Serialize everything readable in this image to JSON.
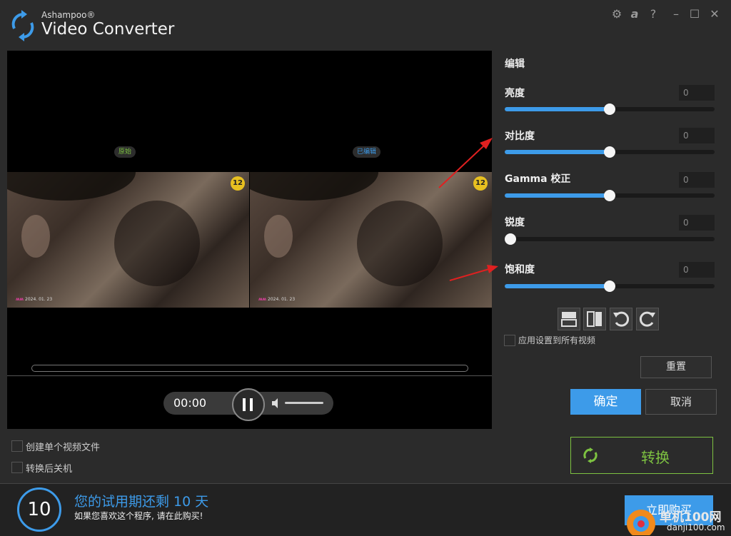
{
  "app": {
    "brand_small": "Ashampoo®",
    "title": "Video Converter"
  },
  "window_controls": [
    "gear-icon",
    "ashampoo-a-icon",
    "help-icon",
    "minimize-icon",
    "maximize-icon",
    "close-icon"
  ],
  "preview": {
    "left_label": "原始",
    "right_label": "已编辑",
    "age_rating": "12",
    "watermark_date": "2024. 01. 23",
    "player": {
      "time": "00:00",
      "volume_icon": "speaker-icon"
    }
  },
  "edit": {
    "title": "编辑",
    "sliders": [
      {
        "label": "亮度",
        "value": "0",
        "level": 0.5
      },
      {
        "label": "对比度",
        "value": "0",
        "level": 0.5
      },
      {
        "label": "Gamma 校正",
        "value": "0",
        "level": 0.5
      },
      {
        "label": "锐度",
        "value": "0",
        "level": 0.0
      },
      {
        "label": "饱和度",
        "value": "0",
        "level": 0.5
      }
    ],
    "tools": [
      "split-horizontal-icon",
      "split-vertical-icon",
      "rotate-left-icon",
      "rotate-right-icon"
    ],
    "apply_all_label": "应用设置到所有视频",
    "reset_label": "重置",
    "ok_label": "确定",
    "cancel_label": "取消"
  },
  "options": {
    "single_file_label": "创建单个视频文件",
    "shutdown_label": "转换后关机"
  },
  "convert_label": "转换",
  "trial": {
    "days": "10",
    "title": "您的试用期还剩 10 天",
    "subtitle": "如果您喜欢这个程序, 请在此购买!",
    "buy_label": "立即购买"
  },
  "site_watermark": {
    "name": "单机100网",
    "url": "danji100.com"
  },
  "colors": {
    "accent": "#3d9be9",
    "convert_green": "#7dc241",
    "annotation_arrow": "#e02020"
  }
}
